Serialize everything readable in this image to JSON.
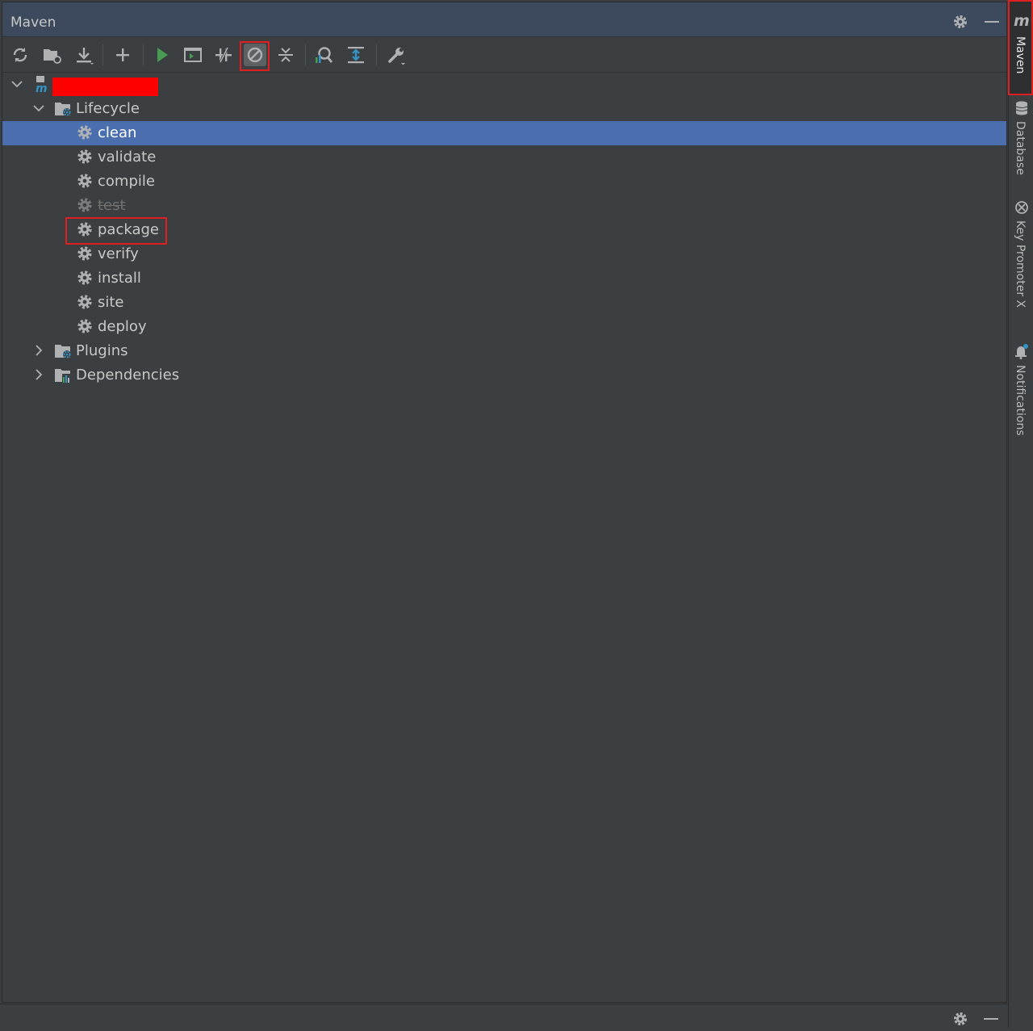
{
  "panel": {
    "title": "Maven",
    "settings_icon": "gear-icon",
    "hide_icon": "minimize-icon"
  },
  "toolbar": {
    "buttons": [
      {
        "name": "reload-all-projects-button",
        "icon": "refresh-icon"
      },
      {
        "name": "generate-sources-button",
        "icon": "folder-refresh-icon"
      },
      {
        "name": "download-sources-button",
        "icon": "download-icon"
      },
      {
        "name": "add-maven-project-button",
        "icon": "plus-icon"
      },
      {
        "name": "run-maven-build-button",
        "icon": "play-icon"
      },
      {
        "name": "execute-maven-goal-button",
        "icon": "terminal-icon"
      },
      {
        "name": "toggle-offline-mode-button",
        "icon": "offline-icon"
      },
      {
        "name": "toggle-skip-tests-button",
        "icon": "skip-tests-icon"
      },
      {
        "name": "collapse-all-button",
        "icon": "collapse-icon"
      },
      {
        "name": "show-dependencies-button",
        "icon": "dependency-analyzer-icon"
      },
      {
        "name": "expand-all-button",
        "icon": "expand-icon"
      },
      {
        "name": "maven-settings-button",
        "icon": "wrench-icon"
      }
    ],
    "colors": {
      "run": "#499c54",
      "icon": "#afb1b3",
      "accent": "#3592c4"
    }
  },
  "tree": {
    "project": {
      "name_redacted": true,
      "icon": "maven-module-icon"
    },
    "lifecycle": {
      "label": "Lifecycle",
      "goals": [
        "clean",
        "validate",
        "compile",
        "test",
        "package",
        "verify",
        "install",
        "site",
        "deploy"
      ],
      "selected": "clean",
      "disabled": [
        "test"
      ]
    },
    "plugins": {
      "label": "Plugins"
    },
    "dependencies": {
      "label": "Dependencies"
    }
  },
  "side_tabs": [
    {
      "label": "Maven",
      "icon": "maven-icon",
      "active": true
    },
    {
      "label": "Database",
      "icon": "database-icon"
    },
    {
      "label": "Key Promoter X",
      "icon": "key-promoter-icon"
    },
    {
      "label": "Notifications",
      "icon": "bell-icon"
    }
  ],
  "highlight_color": "#e02020",
  "selection_color": "#4b6eaf"
}
